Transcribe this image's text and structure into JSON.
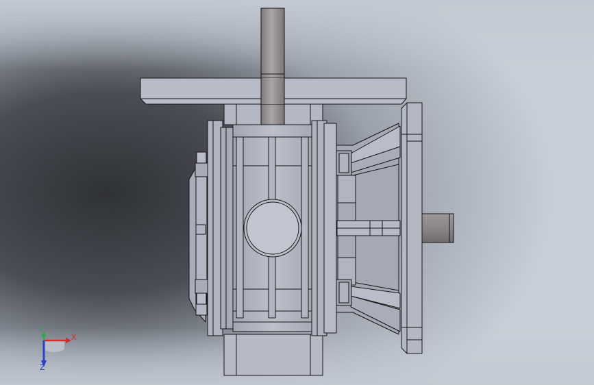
{
  "triad": {
    "x_label": "X",
    "y_label": "Y",
    "z_label": "Z",
    "x_color": "#d42a2a",
    "y_color": "#2fa84a",
    "z_color": "#2a3fd4"
  },
  "colors": {
    "background_light": "#c5cbd4",
    "background_dark": "#3e4147",
    "part_fill": "#b4b8c4",
    "part_fill_light": "#c9ccd6",
    "part_fill_dark": "#9a9eab",
    "shaft_fill": "#8f8b8c",
    "edge": "#141414"
  }
}
